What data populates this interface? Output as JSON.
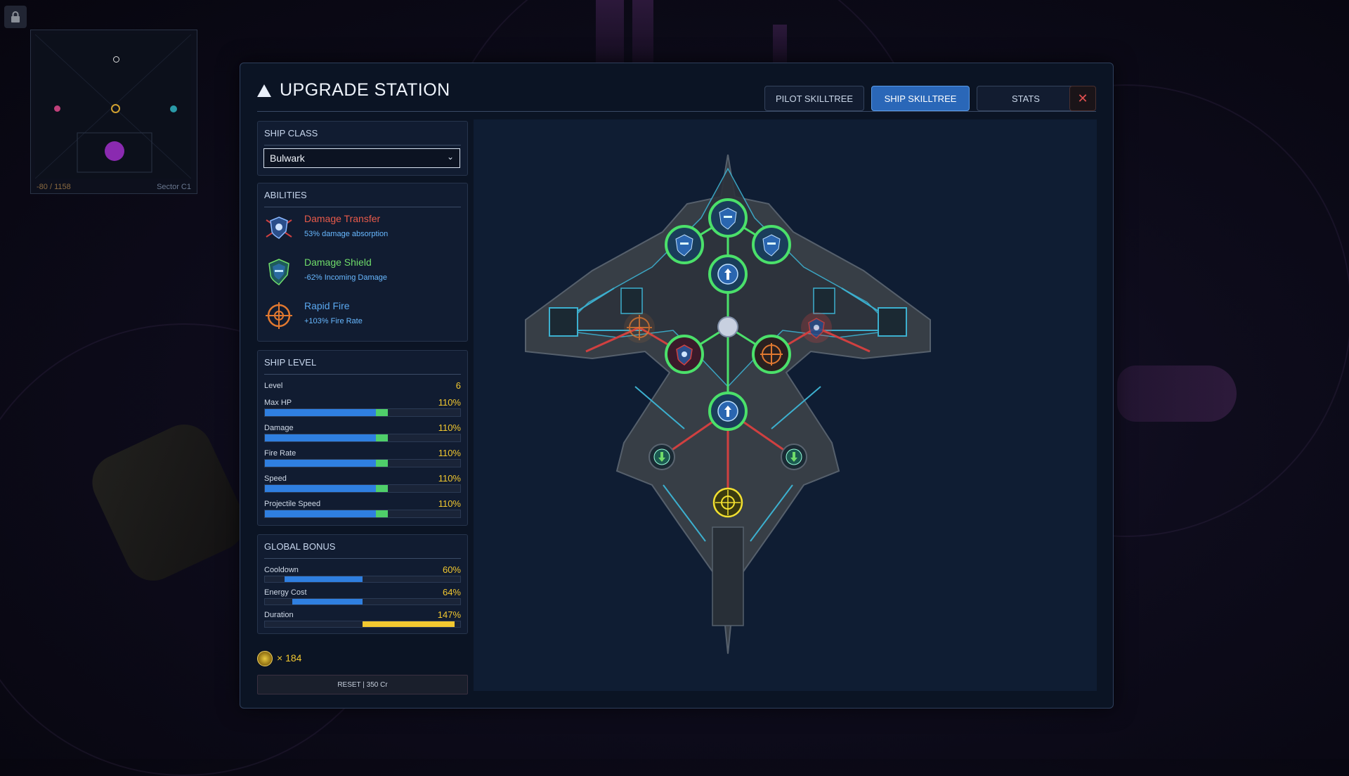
{
  "window": {
    "title": "UPGRADE STATION",
    "tabs": [
      "PILOT SKILLTREE",
      "SHIP SKILLTREE",
      "STATS"
    ],
    "active_tab": "SHIP SKILLTREE",
    "close_icon": "close-icon"
  },
  "minimap": {
    "coords": "-80 / 1158",
    "sector": "Sector C1"
  },
  "ship_class": {
    "title": "SHIP CLASS",
    "selected": "Bulwark"
  },
  "abilities": {
    "title": "ABILITIES",
    "items": [
      {
        "name": "Damage Transfer",
        "desc": "53% damage absorption",
        "color": "#e85a4a",
        "icon": "damage-transfer-icon"
      },
      {
        "name": "Damage Shield",
        "desc": "-62%  Incoming Damage",
        "color": "#6fdc6a",
        "icon": "damage-shield-icon"
      },
      {
        "name": "Rapid Fire",
        "desc": "+103%  Fire Rate",
        "color": "#5aa8f0",
        "icon": "rapid-fire-icon"
      }
    ]
  },
  "ship_level": {
    "title": "SHIP LEVEL",
    "level_label": "Level",
    "level_value": "6",
    "stats": [
      {
        "label": "Max HP",
        "value": "110%",
        "base": 0.57,
        "bonus": 0.06
      },
      {
        "label": "Damage",
        "value": "110%",
        "base": 0.57,
        "bonus": 0.06
      },
      {
        "label": "Fire Rate",
        "value": "110%",
        "base": 0.57,
        "bonus": 0.06
      },
      {
        "label": "Speed",
        "value": "110%",
        "base": 0.57,
        "bonus": 0.06
      },
      {
        "label": "Projectile Speed",
        "value": "110%",
        "base": 0.57,
        "bonus": 0.06
      }
    ]
  },
  "global_bonus": {
    "title": "GLOBAL BONUS",
    "stats": [
      {
        "label": "Cooldown",
        "value": "60%",
        "start": 0.1,
        "end": 0.5,
        "color": "#2f7fe0"
      },
      {
        "label": "Energy Cost",
        "value": "64%",
        "start": 0.14,
        "end": 0.5,
        "color": "#2f7fe0"
      },
      {
        "label": "Duration",
        "value": "147%",
        "start": 0.5,
        "end": 0.97,
        "color": "#f2c830"
      }
    ]
  },
  "credits": {
    "text": "× 184"
  },
  "reset": {
    "label": "RESET  |  350 Cr"
  },
  "colors": {
    "accent": "#2a67b8",
    "node_active": "#4be06a",
    "link_inactive": "#d04040",
    "gold": "#f2c830"
  }
}
